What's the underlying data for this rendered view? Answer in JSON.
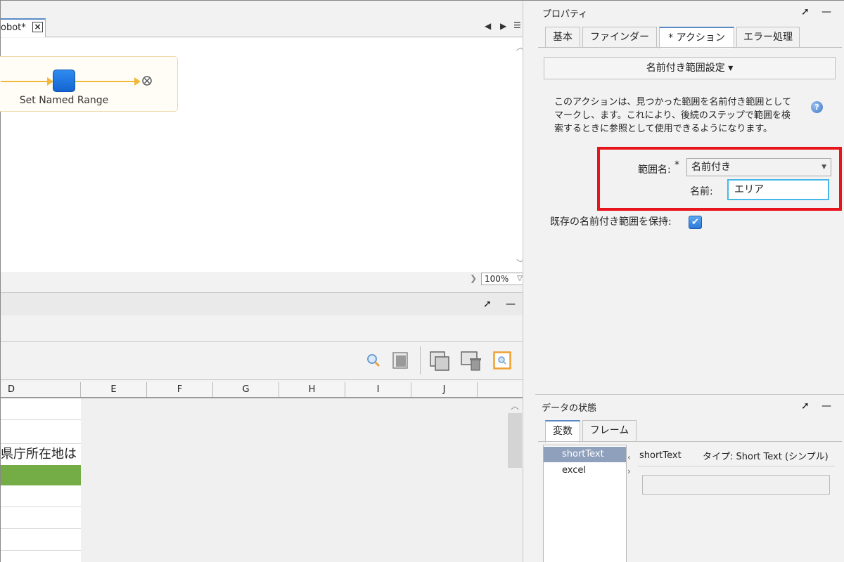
{
  "editor": {
    "tab_label": "obot*",
    "tab_close": "🗙",
    "nav_prev": "◀",
    "nav_next": "▶",
    "nav_menu": "☰",
    "step_label": "Set Named Range",
    "zoom_value": "100%",
    "zoom_toggle": "❯"
  },
  "grid": {
    "columns": [
      "D",
      "E",
      "F",
      "G",
      "H",
      "I",
      "J"
    ],
    "cell_text": "県庁所在地は",
    "highlight_color": "#74ad46"
  },
  "properties": {
    "title": "プロパティ",
    "tabs": [
      "基本",
      "ファインダー",
      "* アクション",
      "エラー処理"
    ],
    "action_dropdown": "名前付き範囲設定 ▾",
    "description": "このアクションは、見つかった範囲を名前付き範囲としてマークし、ます。これにより、後続のステップで範囲を検索するときに参照として使用できるようになります。",
    "help_icon": "?",
    "range_name_label": "範囲名:",
    "required_mark": "*",
    "range_name_value": "名前付き",
    "name_label": "名前:",
    "name_value": "エリア",
    "keep_existing_label": "既存の名前付き範囲を保持:",
    "keep_existing_checked": true,
    "checkmark": "✔",
    "highlight_color": "#e8141c"
  },
  "data_state": {
    "title": "データの状態",
    "tabs": [
      "変数",
      "フレーム"
    ],
    "variables": [
      "shortText",
      "excel"
    ],
    "selected_variable": "shortText",
    "selected_type": "タイプ: Short Text (シンプル)"
  },
  "icons": {
    "pin": "➚",
    "minimize": "—"
  }
}
